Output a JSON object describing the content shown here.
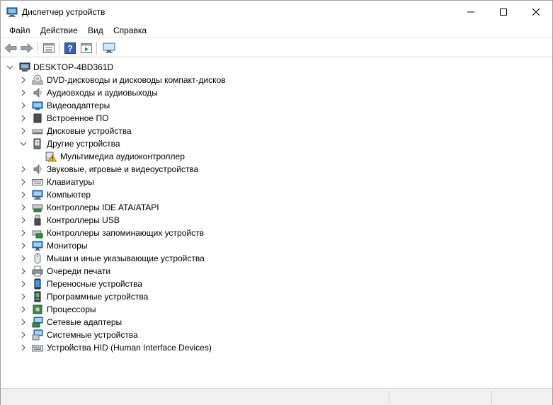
{
  "window": {
    "title": "Диспетчер устройств"
  },
  "menu": {
    "file": "Файл",
    "action": "Действие",
    "view": "Вид",
    "help": "Справка"
  },
  "toolbar": {
    "buttons": [
      "back-icon",
      "forward-icon",
      "properties-icon",
      "help-icon",
      "run-icon",
      "monitor-icon"
    ]
  },
  "tree": {
    "root": "DESKTOP-4BD361D",
    "categories": [
      {
        "label": "DVD-дисководы и дисководы компакт-дисков",
        "icon": "dvd-drive-icon",
        "expanded": false
      },
      {
        "label": "Аудиовходы и аудиовыходы",
        "icon": "speaker-icon",
        "expanded": false
      },
      {
        "label": "Видеоадаптеры",
        "icon": "display-adapter-icon",
        "expanded": false
      },
      {
        "label": "Встроенное ПО",
        "icon": "firmware-icon",
        "expanded": false
      },
      {
        "label": "Дисковые устройства",
        "icon": "disk-drive-icon",
        "expanded": false
      },
      {
        "label": "Другие устройства",
        "icon": "unknown-device-icon",
        "expanded": true,
        "children": [
          {
            "label": "Мультимедиа аудиоконтроллер",
            "icon": "warning-device-icon"
          }
        ]
      },
      {
        "label": "Звуковые, игровые и видеоустройства",
        "icon": "speaker-icon",
        "expanded": false
      },
      {
        "label": "Клавиатуры",
        "icon": "keyboard-icon",
        "expanded": false
      },
      {
        "label": "Компьютер",
        "icon": "computer-icon",
        "expanded": false
      },
      {
        "label": "Контроллеры IDE ATA/ATAPI",
        "icon": "ide-controller-icon",
        "expanded": false
      },
      {
        "label": "Контроллеры USB",
        "icon": "usb-icon",
        "expanded": false
      },
      {
        "label": "Контроллеры запоминающих устройств",
        "icon": "storage-controller-icon",
        "expanded": false
      },
      {
        "label": "Мониторы",
        "icon": "monitor-icon",
        "expanded": false
      },
      {
        "label": "Мыши и иные указывающие устройства",
        "icon": "mouse-icon",
        "expanded": false
      },
      {
        "label": "Очереди печати",
        "icon": "printer-icon",
        "expanded": false
      },
      {
        "label": "Переносные устройства",
        "icon": "portable-device-icon",
        "expanded": false
      },
      {
        "label": "Программные устройства",
        "icon": "software-device-icon",
        "expanded": false
      },
      {
        "label": "Процессоры",
        "icon": "processor-icon",
        "expanded": false
      },
      {
        "label": "Сетевые адаптеры",
        "icon": "network-adapter-icon",
        "expanded": false
      },
      {
        "label": "Системные устройства",
        "icon": "system-device-icon",
        "expanded": false
      },
      {
        "label": "Устройства HID (Human Interface Devices)",
        "icon": "hid-icon",
        "expanded": false
      }
    ]
  },
  "colors": {
    "accent": "#1e7fd6",
    "warning": "#f2c200",
    "chevron": "#555555"
  }
}
